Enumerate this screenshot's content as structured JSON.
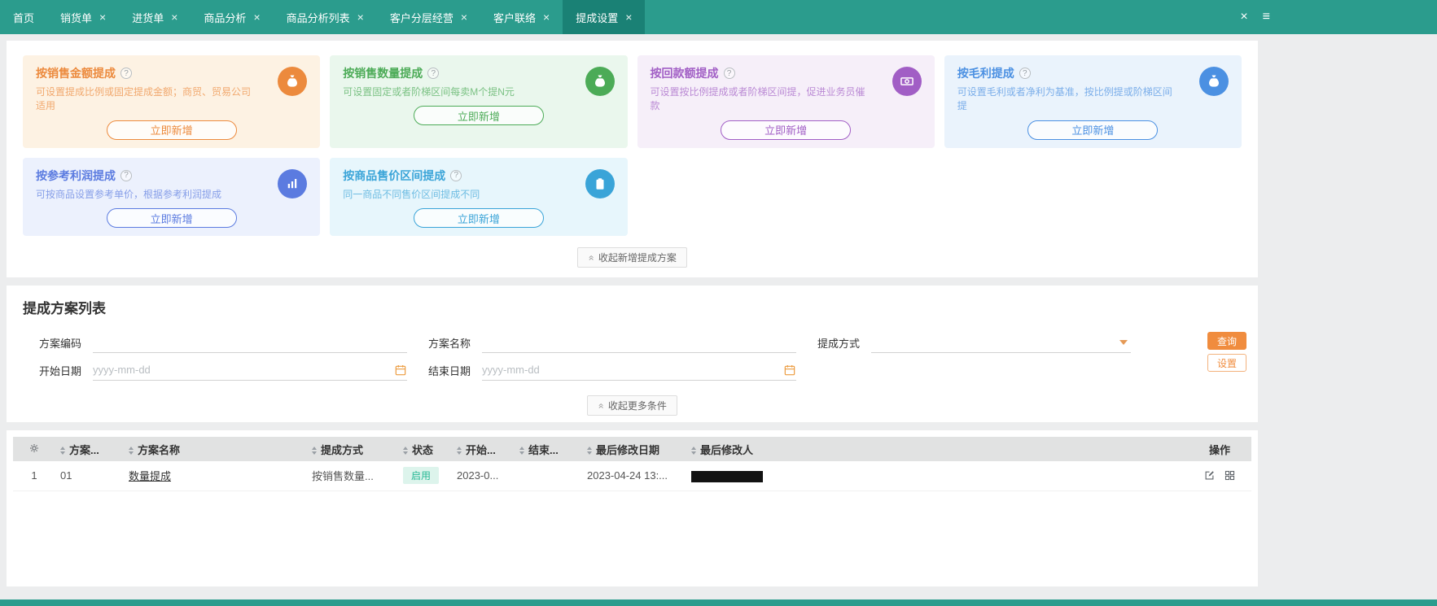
{
  "icons": {
    "close": "×",
    "menu": "≡",
    "double_chevron_up": "»",
    "help": "?"
  },
  "colors": {
    "topbar": "#2b9c8d",
    "active_tab": "#1a8175",
    "primary": "#f08c3e",
    "status_enabled_bg": "#ddf4ec",
    "status_enabled_text": "#27b895"
  },
  "topbar": {
    "tabs": [
      {
        "label": "首页"
      },
      {
        "label": "销货单"
      },
      {
        "label": "进货单"
      },
      {
        "label": "商品分析"
      },
      {
        "label": "商品分析列表"
      },
      {
        "label": "客户分层经营"
      },
      {
        "label": "客户联络"
      },
      {
        "label": "提成设置"
      }
    ]
  },
  "cards": [
    {
      "title": "按销售金额提成",
      "desc": "可设置提成比例或固定提成金额；商贸、贸易公司适用",
      "button": "立即新增",
      "accent": "#ec8a3d",
      "bg": "#fdf2e3",
      "icon": "money-bag"
    },
    {
      "title": "按销售数量提成",
      "desc": "可设置固定或者阶梯区间每卖M个提N元",
      "button": "立即新增",
      "accent": "#4cab57",
      "bg": "#eaf7ed",
      "icon": "money-bag"
    },
    {
      "title": "按回款额提成",
      "desc": "可设置按比例提成或者阶梯区间提，促进业务员催款",
      "button": "立即新增",
      "accent": "#a15ec5",
      "bg": "#f6eff9",
      "icon": "banknote"
    },
    {
      "title": "按毛利提成",
      "desc": "可设置毛利或者净利为基准，按比例提或阶梯区间提",
      "button": "立即新增",
      "accent": "#4b90e2",
      "bg": "#eaf3fc",
      "icon": "money-bag"
    },
    {
      "title": "按参考利润提成",
      "desc": "可按商品设置参考单价，根据参考利润提成",
      "button": "立即新增",
      "accent": "#5b7be0",
      "bg": "#ecf1fd",
      "icon": "bar-chart"
    },
    {
      "title": "按商品售价区间提成",
      "desc": "同一商品不同售价区间提成不同",
      "button": "立即新增",
      "accent": "#3aa4d8",
      "bg": "#e7f6fc",
      "icon": "clipboard"
    }
  ],
  "cards_collapse_label": "收起新增提成方案",
  "list": {
    "title": "提成方案列表",
    "filters": {
      "code_label": "方案编码",
      "name_label": "方案名称",
      "method_label": "提成方式",
      "start_label": "开始日期",
      "end_label": "结束日期",
      "date_placeholder": "yyyy-mm-dd",
      "search_button": "查询",
      "settings_button": "设置",
      "collapse_label": "收起更多条件"
    },
    "table": {
      "columns": [
        {
          "label": "方案..."
        },
        {
          "label": "方案名称"
        },
        {
          "label": "提成方式"
        },
        {
          "label": "状态"
        },
        {
          "label": "开始..."
        },
        {
          "label": "结束..."
        },
        {
          "label": "最后修改日期"
        },
        {
          "label": "最后修改人"
        },
        {
          "label": "操作"
        }
      ],
      "rows": [
        {
          "seq": "1",
          "code": "01",
          "name": "数量提成",
          "method": "按销售数量...",
          "status": "启用",
          "start": "2023-0...",
          "end": "",
          "modified_date": "2023-04-24 13:...",
          "modified_by_redacted": true
        }
      ]
    }
  }
}
